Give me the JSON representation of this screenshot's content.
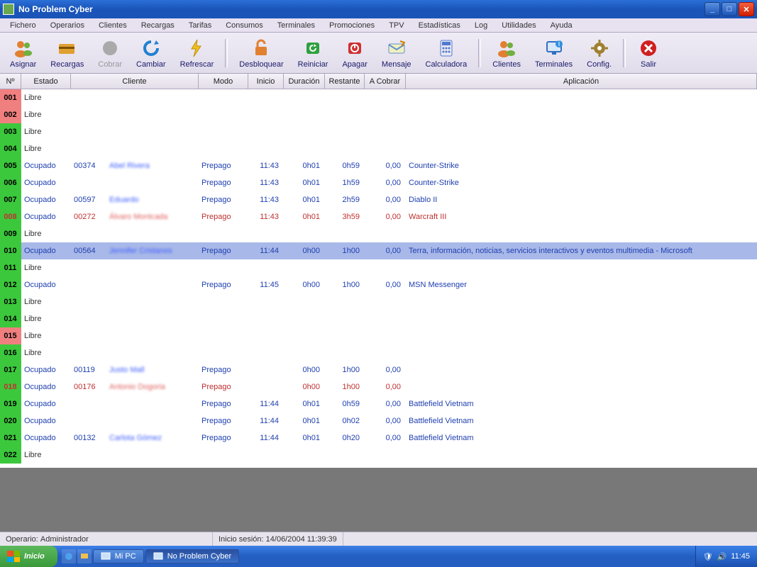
{
  "window": {
    "title": "No Problem Cyber"
  },
  "menu": [
    "Fichero",
    "Operarios",
    "Clientes",
    "Recargas",
    "Tarifas",
    "Consumos",
    "Terminales",
    "Promociones",
    "TPV",
    "Estadísticas",
    "Log",
    "Utilidades",
    "Ayuda"
  ],
  "toolbar": [
    {
      "id": "asignar",
      "label": "Asignar",
      "icon": "people-icon",
      "color": "#e08030"
    },
    {
      "id": "recargas",
      "label": "Recargas",
      "icon": "card-icon",
      "color": "#e0a030"
    },
    {
      "id": "cobrar",
      "label": "Cobrar",
      "icon": "coin-icon",
      "color": "#aaa",
      "disabled": true
    },
    {
      "id": "cambiar",
      "label": "Cambiar",
      "icon": "refresh-icon",
      "color": "#2080d0"
    },
    {
      "id": "refrescar",
      "label": "Refrescar",
      "icon": "bolt-icon",
      "color": "#f0c020"
    },
    {
      "sep": true
    },
    {
      "id": "desbloquear",
      "label": "Desbloquear",
      "icon": "unlock-icon",
      "color": "#e08030"
    },
    {
      "id": "reiniciar",
      "label": "Reiniciar",
      "icon": "restart-icon",
      "color": "#30a040"
    },
    {
      "id": "apagar",
      "label": "Apagar",
      "icon": "power-icon",
      "color": "#d03030"
    },
    {
      "id": "mensaje",
      "label": "Mensaje",
      "icon": "message-icon",
      "color": "#6090d0"
    },
    {
      "id": "calculadora",
      "label": "Calculadora",
      "icon": "calc-icon",
      "color": "#5078d0"
    },
    {
      "sep": true
    },
    {
      "id": "clientes",
      "label": "Clientes",
      "icon": "people-icon",
      "color": "#e08030"
    },
    {
      "id": "terminales",
      "label": "Terminales",
      "icon": "monitor-icon",
      "color": "#3070c0"
    },
    {
      "id": "config",
      "label": "Config.",
      "icon": "gear-icon",
      "color": "#a08030"
    },
    {
      "sep": true
    },
    {
      "id": "salir",
      "label": "Salir",
      "icon": "close-icon",
      "color": "#d02020"
    }
  ],
  "columns": [
    "Nº",
    "Estado",
    "Cliente",
    "Modo",
    "Inicio",
    "Duración",
    "Restante",
    "A Cobrar",
    "Aplicación"
  ],
  "rows": [
    {
      "n": "001",
      "badge": "red",
      "estado": "Libre"
    },
    {
      "n": "002",
      "badge": "red",
      "estado": "Libre"
    },
    {
      "n": "003",
      "badge": "green",
      "estado": "Libre"
    },
    {
      "n": "004",
      "badge": "green",
      "estado": "Libre"
    },
    {
      "n": "005",
      "badge": "green",
      "estado": "Ocupado",
      "cliId": "00374",
      "cliName": "Abel Rivera",
      "modo": "Prepago",
      "inicio": "11:43",
      "dur": "0h01",
      "rest": "0h59",
      "cob": "0,00",
      "app": "Counter-Strike"
    },
    {
      "n": "006",
      "badge": "green",
      "estado": "Ocupado",
      "modo": "Prepago",
      "inicio": "11:43",
      "dur": "0h01",
      "rest": "1h59",
      "cob": "0,00",
      "app": "Counter-Strike"
    },
    {
      "n": "007",
      "badge": "green",
      "estado": "Ocupado",
      "cliId": "00597",
      "cliName": "Eduardo",
      "modo": "Prepago",
      "inicio": "11:43",
      "dur": "0h01",
      "rest": "2h59",
      "cob": "0,00",
      "app": "Diablo II"
    },
    {
      "n": "008",
      "badge": "green",
      "estado": "Ocupado",
      "warn": true,
      "cliId": "00272",
      "cliName": "Álvaro Montcada",
      "modo": "Prepago",
      "inicio": "11:43",
      "dur": "0h01",
      "rest": "3h59",
      "cob": "0,00",
      "app": "Warcraft III"
    },
    {
      "n": "009",
      "badge": "green",
      "estado": "Libre"
    },
    {
      "n": "010",
      "badge": "green",
      "estado": "Ocupado",
      "selected": true,
      "cliId": "00564",
      "cliName": "Jennifer Cristanos",
      "modo": "Prepago",
      "inicio": "11:44",
      "dur": "0h00",
      "rest": "1h00",
      "cob": "0,00",
      "app": "Terra, información, noticias, servicios interactivos y eventos multimedia - Microsoft"
    },
    {
      "n": "011",
      "badge": "green",
      "estado": "Libre"
    },
    {
      "n": "012",
      "badge": "green",
      "estado": "Ocupado",
      "modo": "Prepago",
      "inicio": "11:45",
      "dur": "0h00",
      "rest": "1h00",
      "cob": "0,00",
      "app": "MSN Messenger"
    },
    {
      "n": "013",
      "badge": "green",
      "estado": "Libre"
    },
    {
      "n": "014",
      "badge": "green",
      "estado": "Libre"
    },
    {
      "n": "015",
      "badge": "red",
      "estado": "Libre"
    },
    {
      "n": "016",
      "badge": "green",
      "estado": "Libre"
    },
    {
      "n": "017",
      "badge": "green",
      "estado": "Ocupado",
      "cliId": "00119",
      "cliName": "Justo Mall",
      "modo": "Prepago",
      "dur": "0h00",
      "rest": "1h00",
      "cob": "0,00"
    },
    {
      "n": "018",
      "badge": "green",
      "estado": "Ocupado",
      "warn": true,
      "cliId": "00176",
      "cliName": "Antonio Dogoria",
      "modo": "Prepago",
      "dur": "0h00",
      "rest": "1h00",
      "cob": "0,00"
    },
    {
      "n": "019",
      "badge": "green",
      "estado": "Ocupado",
      "modo": "Prepago",
      "inicio": "11:44",
      "dur": "0h01",
      "rest": "0h59",
      "cob": "0,00",
      "app": "Battlefield Vietnam"
    },
    {
      "n": "020",
      "badge": "green",
      "estado": "Ocupado",
      "modo": "Prepago",
      "inicio": "11:44",
      "dur": "0h01",
      "rest": "0h02",
      "cob": "0,00",
      "app": "Battlefield Vietnam"
    },
    {
      "n": "021",
      "badge": "green",
      "estado": "Ocupado",
      "cliId": "00132",
      "cliName": "Carlota Gómez",
      "modo": "Prepago",
      "inicio": "11:44",
      "dur": "0h01",
      "rest": "0h20",
      "cob": "0,00",
      "app": "Battlefield Vietnam"
    },
    {
      "n": "022",
      "badge": "green",
      "estado": "Libre"
    }
  ],
  "status": {
    "operario_label": "Operario:",
    "operario": "Administrador",
    "sesion_label": "Inicio sesión:",
    "sesion": "14/06/2004  11:39:39"
  },
  "taskbar": {
    "start": "Inicio",
    "tasks": [
      {
        "label": "Mi PC",
        "icon": "monitor-icon"
      },
      {
        "label": "No Problem Cyber",
        "icon": "app-icon",
        "active": true
      }
    ],
    "clock": "11:45"
  }
}
